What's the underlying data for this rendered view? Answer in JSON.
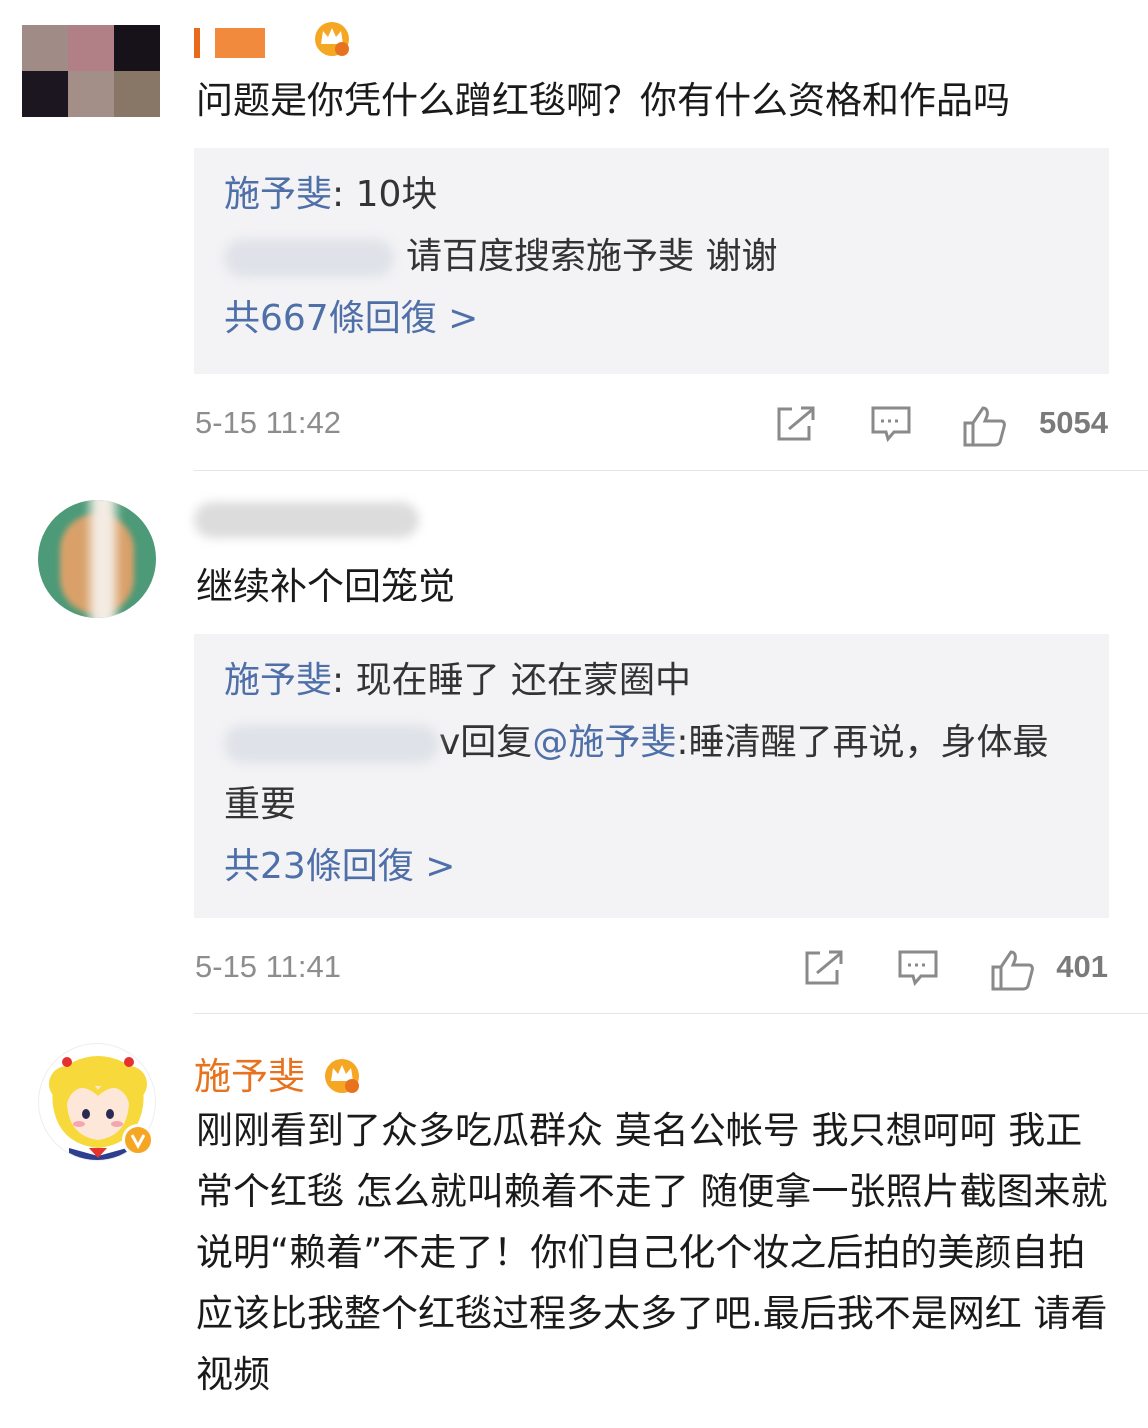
{
  "comments": [
    {
      "username": "",
      "text": "问题是你凭什么蹭红毯啊？你有什么资格和作品吗",
      "replies": [
        {
          "name": "施予斐",
          "sep": ": ",
          "text": "10块"
        },
        {
          "name": "",
          "sep": "",
          "text": "请百度搜索施予斐 谢谢"
        }
      ],
      "reply_count": "共667條回復 >",
      "time": "5-15 11:42",
      "likes": "5054"
    },
    {
      "username": "",
      "text": "继续补个回笼觉",
      "replies": [
        {
          "name": "施予斐",
          "sep": ": ",
          "text": "现在睡了 还在蒙圈中"
        },
        {
          "prefix": "v回复",
          "mention": "@施予斐",
          "text": ":睡清醒了再说，身体最重要"
        }
      ],
      "reply_count": "共23條回復 >",
      "time": "5-15 11:41",
      "likes": "401"
    },
    {
      "username": "施予斐",
      "text": "刚刚看到了众多吃瓜群众 莫名公帐号 我只想呵呵 我正常个红毯 怎么就叫赖着不走了 随便拿一张照片截图来就说明“赖着”不走了！你们自己化个妆之后拍的美颜自拍应该比我整个红毯过程多太多了吧.最后我不是网红 请看视频"
    }
  ],
  "colors": {
    "link_blue": "#4e6fa8",
    "username_orange": "#e8731e",
    "reply_bg": "#f3f3f5",
    "crown_gold": "#f5a623"
  },
  "icons": [
    "share-icon",
    "comment-icon",
    "like-icon",
    "crown-badge-icon",
    "verified-icon"
  ]
}
